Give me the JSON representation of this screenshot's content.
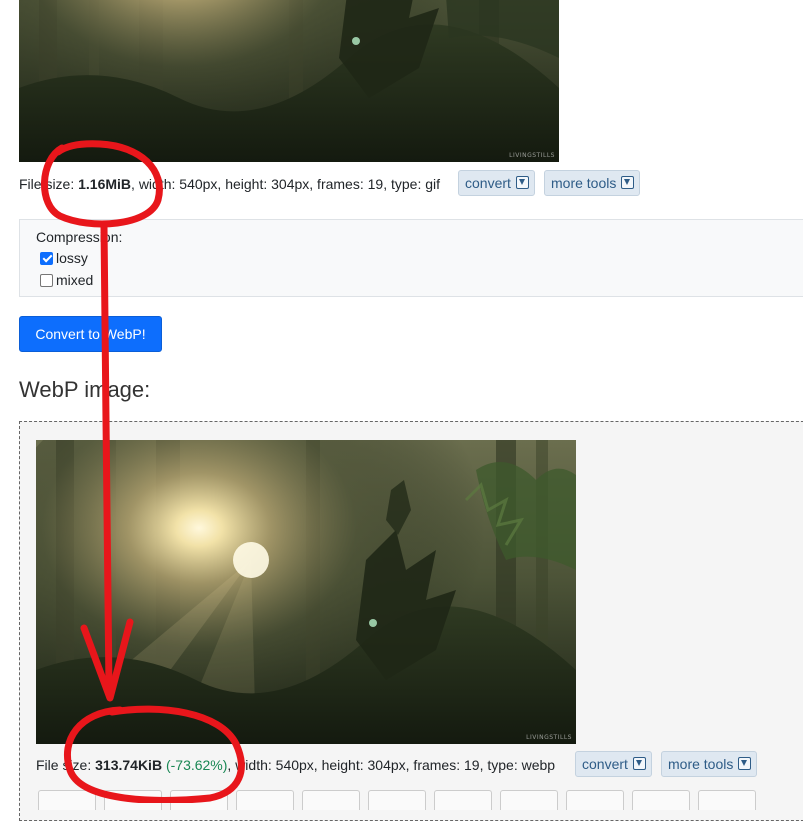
{
  "original": {
    "file_size_label": "File size:",
    "file_size": "1.16MiB",
    "details": ", width: 540px, height: 304px, frames: 19, type: gif",
    "convert_label": "convert",
    "more_tools_label": "more tools",
    "watermark": "LIVINGSTILLS"
  },
  "options": {
    "compression_label": "Compression:",
    "lossy_label": "lossy",
    "lossy_checked": true,
    "mixed_label": "mixed",
    "mixed_checked": false
  },
  "convert_button_label": "Convert to WebP!",
  "result": {
    "heading": "WebP image:",
    "file_size_label": "File size:",
    "file_size": "313.74KiB",
    "savings": "(-73.62%)",
    "details": ", width: 540px, height: 304px, frames: 19, type: webp",
    "convert_label": "convert",
    "more_tools_label": "more tools",
    "watermark": "LIVINGSTILLS"
  },
  "icons": {
    "download": "download-icon",
    "annotation": "red-arrow-annotation"
  },
  "colors": {
    "primary_button": "#0d6efd",
    "tool_button_bg": "#dfe8f1",
    "savings_text": "#198754",
    "annotation_red": "#e8161b"
  }
}
